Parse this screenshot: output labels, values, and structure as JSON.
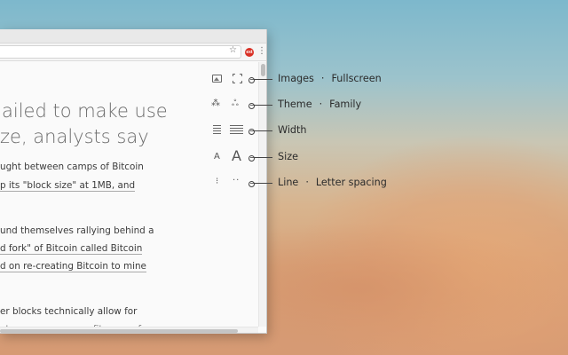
{
  "browser": {
    "star_icon": "star-icon",
    "extension_badge": "ext"
  },
  "article": {
    "headline_line1": "ailed to make use",
    "headline_line2": "ze, analysts say",
    "body_lines": [
      "ught between camps of Bitcoin",
      "p its \"block size\" at 1MB, and",
      "und themselves rallying behind a",
      "d fork\" of Bitcoin called Bitcoin",
      "d on re-creating Bitcoin to mine",
      "er blocks technically allow for",
      "at once, so you can fit more of"
    ]
  },
  "features": {
    "images": "Images",
    "fullscreen": "Fullscreen",
    "theme": "Theme",
    "family": "Family",
    "width": "Width",
    "size": "Size",
    "line": "Line",
    "letter_spacing": "Letter spacing",
    "separator": "·"
  },
  "icons": {
    "theme_glyph": "⁂",
    "family_glyph": "ஃ",
    "size_small": "A",
    "size_large": "A",
    "line_glyph": "⁝",
    "letter_glyph": "··"
  }
}
